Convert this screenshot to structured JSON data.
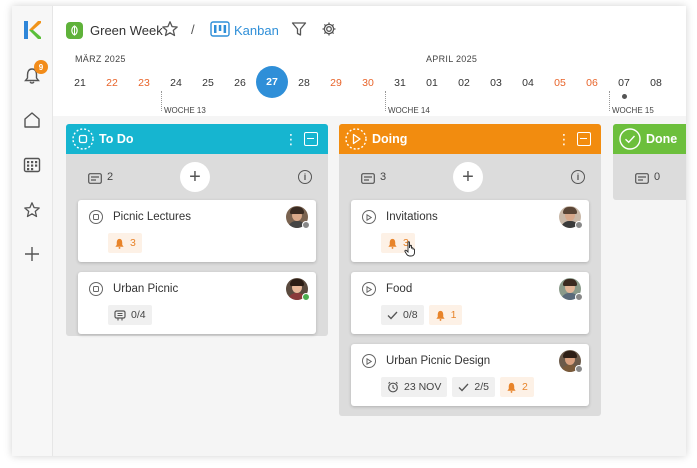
{
  "header": {
    "project_name": "Green Week",
    "separator": "/",
    "view_label": "Kanban"
  },
  "sidebar": {
    "notification_count": "9",
    "items": [
      {
        "icon": "logo-icon"
      },
      {
        "icon": "bell-icon"
      },
      {
        "icon": "home-icon"
      },
      {
        "icon": "grid-icon"
      },
      {
        "icon": "star-icon"
      },
      {
        "icon": "plus-icon"
      }
    ]
  },
  "timeline": {
    "months": [
      {
        "label": "MÄRZ 2025"
      },
      {
        "label": "APRIL 2025"
      }
    ],
    "days": [
      {
        "label": "21",
        "weekend": false
      },
      {
        "label": "22",
        "weekend": true
      },
      {
        "label": "23",
        "weekend": true
      },
      {
        "label": "24",
        "weekend": false
      },
      {
        "label": "25",
        "weekend": false
      },
      {
        "label": "26",
        "weekend": false
      },
      {
        "label": "27",
        "weekend": false,
        "today": true
      },
      {
        "label": "28",
        "weekend": false
      },
      {
        "label": "29",
        "weekend": true
      },
      {
        "label": "30",
        "weekend": true
      },
      {
        "label": "31",
        "weekend": false
      },
      {
        "label": "01",
        "weekend": false
      },
      {
        "label": "02",
        "weekend": false
      },
      {
        "label": "03",
        "weekend": false
      },
      {
        "label": "04",
        "weekend": false
      },
      {
        "label": "05",
        "weekend": true
      },
      {
        "label": "06",
        "weekend": true
      },
      {
        "label": "07",
        "weekend": false
      },
      {
        "label": "08",
        "weekend": false
      }
    ],
    "weeks": [
      "WOCHE 13",
      "WOCHE 14",
      "WOCHE 15"
    ]
  },
  "columns": [
    {
      "title": "To Do",
      "color": "#16b5d0",
      "count": "2",
      "cards": [
        {
          "title": "Picnic Lectures",
          "tags": [
            {
              "type": "bell",
              "text": "3"
            }
          ]
        },
        {
          "title": "Urban Picnic",
          "tags": [
            {
              "type": "checklist",
              "text": "0/4"
            }
          ]
        }
      ]
    },
    {
      "title": "Doing",
      "color": "#f28c0f",
      "count": "3",
      "cards": [
        {
          "title": "Invitations",
          "tags": [
            {
              "type": "bell",
              "text": "3"
            }
          ]
        },
        {
          "title": "Food",
          "tags": [
            {
              "type": "check",
              "text": "0/8"
            },
            {
              "type": "bell",
              "text": "1"
            }
          ]
        },
        {
          "title": "Urban Picnic Design",
          "tags": [
            {
              "type": "date",
              "text": "23 NOV"
            },
            {
              "type": "check",
              "text": "2/5"
            },
            {
              "type": "bell",
              "text": "2"
            }
          ]
        }
      ]
    },
    {
      "title": "Done",
      "color": "#6cbf3c",
      "count": "0",
      "cards": []
    }
  ],
  "colors": {
    "accent": "#2f8fd8",
    "weekend": "#e8642a",
    "badge": "#f28c1a"
  }
}
